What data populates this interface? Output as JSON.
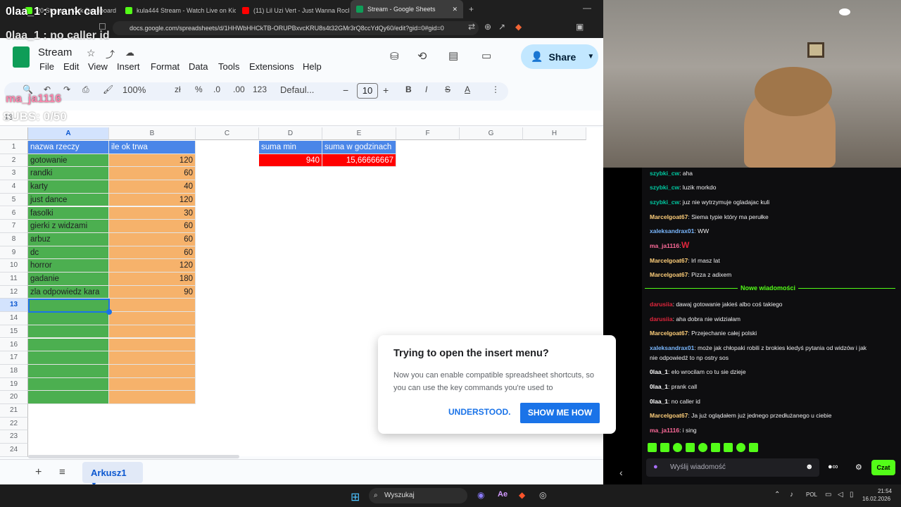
{
  "overlay": {
    "top_msg": "0laa_1 : prank call",
    "second_msg": "0laa_1 : no caller id",
    "user1": "ma_ja1116",
    "subs": "SUBS: 0/50"
  },
  "browser": {
    "tabs": [
      "20 Stream - Kick Dashboard",
      "kula444 Stream - Watch Live on Kick",
      "(11) Lil Uzi Vert - Just Wanna Rock",
      "Stream - Google Sheets"
    ],
    "url": "docs.google.com/spreadsheets/d/1HHWbHHCkTB-ORUPBxvcKRU8s4t32GMr3rQ8ccYdQy60/edit?gid=0#gid=0"
  },
  "sheets": {
    "title": "Stream",
    "menus": [
      "File",
      "Edit",
      "View",
      "Insert",
      "Format",
      "Data",
      "Tools",
      "Extensions",
      "Help"
    ],
    "share_label": "Share",
    "zoom": "100%",
    "currency": "zł",
    "percent": "%",
    "dec_less": ".0",
    ".00": ".00",
    "format123": "123",
    "font": "Defaul...",
    "font_size": "10",
    "cell_ref": "13",
    "columns": [
      "A",
      "B",
      "C",
      "D",
      "E",
      "F",
      "G",
      "H"
    ],
    "rows": [
      "1",
      "2",
      "3",
      "4",
      "5",
      "6",
      "7",
      "8",
      "9",
      "10",
      "11",
      "12",
      "13",
      "14",
      "15",
      "16",
      "17",
      "18",
      "19",
      "20",
      "21",
      "22",
      "23",
      "24"
    ],
    "header_a": "nazwa rzeczy",
    "header_b": "ile ok trwa",
    "header_d": "suma min",
    "header_e": "suma w godzinach",
    "sum_min": "940",
    "sum_hours": "15,66666667",
    "items": [
      {
        "name": "gotowanie",
        "min": "120"
      },
      {
        "name": "randki",
        "min": "60"
      },
      {
        "name": "karty",
        "min": "40"
      },
      {
        "name": "just dance",
        "min": "120"
      },
      {
        "name": "fasolki",
        "min": "30"
      },
      {
        "name": "gierki z widzami",
        "min": "60"
      },
      {
        "name": "arbuz",
        "min": "60"
      },
      {
        "name": "dc",
        "min": "60"
      },
      {
        "name": "horror",
        "min": "120"
      },
      {
        "name": "gadanie",
        "min": "180"
      },
      {
        "name": "zla odpowiedz kara",
        "min": "90"
      }
    ],
    "sheet_tab": "Arkusz1"
  },
  "dialog": {
    "title": "Trying to open the insert menu?",
    "body": "Now you can enable compatible spreadsheet shortcuts, so you can use the key commands you're used to",
    "understood": "UNDERSTOOD.",
    "show_me": "SHOW ME HOW"
  },
  "chat": {
    "new_messages": "Nowe wiadomości",
    "messages": [
      {
        "user": "szybki_cw",
        "text": ": aha",
        "color": "#00c8a0"
      },
      {
        "user": "szybki_cw",
        "text": ": luzik morkdo",
        "color": "#00c8a0"
      },
      {
        "user": "szybki_cw",
        "text": ": juz nie wytrzymuje ogladajac kuli",
        "color": "#00c8a0"
      },
      {
        "user": "Marcelgoat67",
        "text": ": Siema typie który ma perułke",
        "color": "#ffcf7a"
      },
      {
        "user": "xaleksandrax01",
        "text": ": WW",
        "color": "#7ab8ff"
      },
      {
        "user": "ma_ja1116",
        "text": ":",
        "color": "#ff6b9a"
      },
      {
        "user": "Marcelgoat67",
        "text": ": lrl masz lat",
        "color": "#ffcf7a"
      },
      {
        "user": "Marcelgoat67",
        "text": ": Pizza z adixem",
        "color": "#ffcf7a"
      },
      {
        "user": "darusiia",
        "text": ": dawaj gotowanie jakieś albo coś takiego",
        "color": "#e0263c"
      },
      {
        "user": "darusiia",
        "text": ": aha dobra nie widziałam",
        "color": "#e0263c"
      },
      {
        "user": "Marcelgoat67",
        "text": ": Przejechanie całej polski",
        "color": "#ffcf7a"
      },
      {
        "user": "xaleksandrax01",
        "text": ": może jak chłopaki robili z brokies kiedyś pytania od widzów i jak",
        "color": "#7ab8ff"
      },
      {
        "user": "",
        "text": "nie odpowiedź to np ostry sos",
        "color": "#7ab8ff"
      },
      {
        "user": "0laa_1",
        "text": ": elo wrocilam co tu sie dzieje",
        "color": "#ffffff"
      },
      {
        "user": "0laa_1",
        "text": ": prank call",
        "color": "#ffffff"
      },
      {
        "user": "0laa_1",
        "text": ": no caller id",
        "color": "#ffffff"
      },
      {
        "user": "Marcelgoat67",
        "text": ": Ja już oglądałem już jednego przedłużanego u ciebie",
        "color": "#ffcf7a"
      },
      {
        "user": "ma_ja1116",
        "text": ": i sing",
        "color": "#ff6b9a"
      }
    ],
    "input_placeholder": "Wyślij wiadomość",
    "chat_button": "Czat",
    "w_badge": "W"
  },
  "taskbar": {
    "search": "Wyszukaj",
    "lang": "POL",
    "time": "21:54",
    "date": "16.02.2026"
  }
}
